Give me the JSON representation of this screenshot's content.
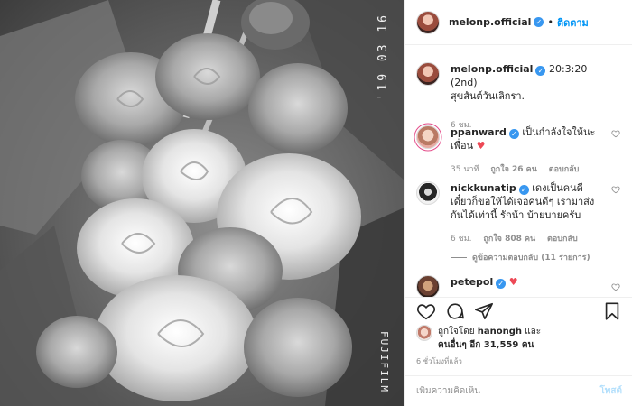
{
  "header": {
    "username": "melonp.official",
    "separator": "•",
    "follow_label": "ติดตาม"
  },
  "photo": {
    "date_stamp": "'19 03 16",
    "film_stamp": "FUJIFILM"
  },
  "caption": {
    "username": "melonp.official",
    "text_part1": "20:3:20 (2nd)",
    "text_part2": "สุขสันต์วันเลิกรา.",
    "time": "6 ชม."
  },
  "comments": [
    {
      "username": "ppanward",
      "text": "เป็นกำลังใจให้นะเพื่อน",
      "emoji": "♥",
      "time": "35 นาที",
      "likes": "ถูกใจ 26 คน",
      "reply": "ตอบกลับ"
    },
    {
      "username": "nickkunatip",
      "text": "เดงเป็นคนดี เดี๋ยวก็ขอให้ได้เจอคนดีๆ เรามาส่งกันได้เท่านี้ รักน้า บ้ายบายครับ",
      "time": "6 ชม.",
      "likes": "ถูกใจ 808 คน",
      "reply": "ตอบกลับ",
      "view_replies": "ดูข้อความตอบกลับ (11 รายการ)"
    },
    {
      "username": "petepol",
      "emoji": "♥"
    }
  ],
  "likes": {
    "prefix": "ถูกใจโดย",
    "user": "hanongh",
    "mid": "และ",
    "others": "คนอื่นๆ อีก 31,559 คน"
  },
  "time_ago": "6 ชั่วโมงที่แล้ว",
  "add_comment": {
    "placeholder": "เพิ่มความคิดเห็น",
    "post_label": "โพสต์"
  },
  "icons": [
    "verified-badge-icon",
    "heart-icon",
    "comment-icon",
    "share-icon",
    "bookmark-icon"
  ],
  "colors": {
    "accent": "#0095f6",
    "red": "#ed4956",
    "muted": "#8e8e8e"
  }
}
